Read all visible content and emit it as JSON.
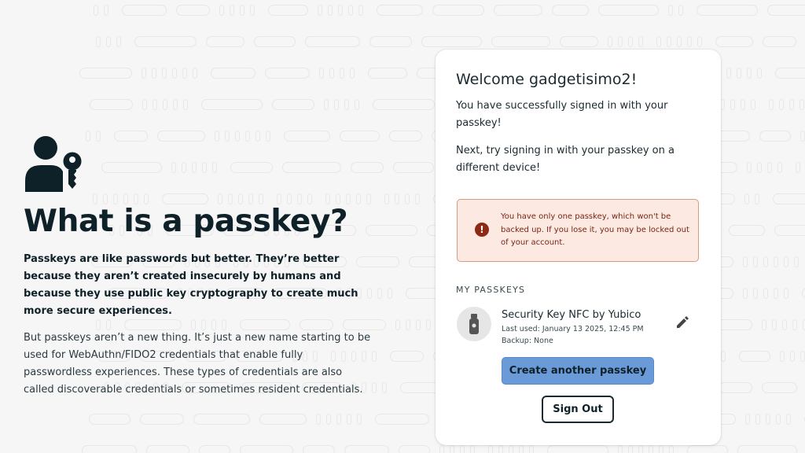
{
  "info": {
    "title": "What is a passkey?",
    "lead": "Passkeys are like passwords but better. They’re better because they aren’t created insecurely by humans and because they use public key cryptography to create much more secure experiences.",
    "body": "But passkeys aren’t a new thing. It’s just a new name starting to be used for WebAuthn/FIDO2 credentials that enable fully passwordless experiences. These types of credentials are also called discoverable credentials or sometimes resident credentials.",
    "icon": "user-key-icon"
  },
  "card": {
    "welcome": "Welcome gadgetisimo2!",
    "message1": "You have successfully signed in with your passkey!",
    "message2": "Next, try signing in with your passkey on a different device!",
    "warning": {
      "icon": "!",
      "text": "You have only one passkey, which won't be backed up. If you lose it, you may be locked out of your account."
    },
    "section_title": "MY PASSKEYS",
    "passkey": {
      "name": "Security Key NFC by Yubico",
      "last_used": "Last used: January 13 2025, 12:45 PM",
      "backup": "Backup: None",
      "icon": "usb-key-icon"
    },
    "create_button": "Create another passkey",
    "signout_button": "Sign Out"
  },
  "colors": {
    "accent": "#6b9ad8",
    "warning_bg": "#fbe9e2",
    "warning_border": "#d99a7e",
    "warning_text": "#7a2512",
    "text_dark": "#0f2128"
  }
}
